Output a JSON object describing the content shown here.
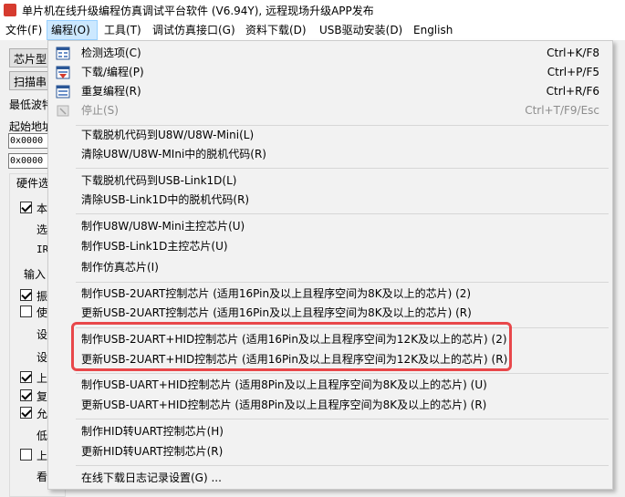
{
  "window": {
    "title": "单片机在线升级编程仿真调试平台软件 (V6.94Y), 远程现场升级APP发布"
  },
  "menubar": {
    "items": [
      {
        "label": "文件(F)"
      },
      {
        "label": "编程(O)"
      },
      {
        "label": "工具(T)"
      },
      {
        "label": "调试仿真接口(G)"
      },
      {
        "label": "资料下载(D)"
      },
      {
        "label": "USB驱动安装(D)"
      },
      {
        "label": "English"
      }
    ]
  },
  "background": {
    "chip_type_label": "芯片型",
    "scan_label": "扫描串",
    "min_baud_label": "最低波特",
    "start_addr_label": "起始地址",
    "addr1": "0x0000",
    "addr2": "0x0000",
    "hw_tab_label": "硬件选",
    "options": [
      {
        "label": "本",
        "checked": true
      },
      {
        "label": "选",
        "checked": null
      },
      {
        "label": "IR",
        "checked": null
      },
      {
        "label": "输入",
        "checked": null
      },
      {
        "label": "振",
        "checked": true
      },
      {
        "label": "使",
        "checked": false
      },
      {
        "label": "设",
        "checked": null
      },
      {
        "label": "设",
        "checked": null
      },
      {
        "label": "上",
        "checked": true
      },
      {
        "label": "复",
        "checked": true
      },
      {
        "label": "允",
        "checked": true
      },
      {
        "label": "低",
        "checked": null
      },
      {
        "label": "上",
        "checked": false
      },
      {
        "label": "看",
        "checked": null
      }
    ]
  },
  "dropdown": {
    "items": [
      {
        "label": "检测选项(C)",
        "shortcut": "Ctrl+K/F8",
        "icon": "detect-icon"
      },
      {
        "label": "下载/编程(P)",
        "shortcut": "Ctrl+P/F5",
        "icon": "download-program-icon"
      },
      {
        "label": "重复编程(R)",
        "shortcut": "Ctrl+R/F6",
        "icon": "repeat-program-icon"
      },
      {
        "label": "停止(S)",
        "shortcut": "Ctrl+T/F9/Esc",
        "icon": "stop-icon",
        "disabled": true
      },
      {
        "label": "下载脱机代码到U8W/U8W-Mini(L)",
        "shortcut": ""
      },
      {
        "label": "清除U8W/U8W-MIni中的脱机代码(R)",
        "shortcut": ""
      },
      {
        "label": "下载脱机代码到USB-Link1D(L)",
        "shortcut": ""
      },
      {
        "label": "清除USB-Link1D中的脱机代码(R)",
        "shortcut": ""
      },
      {
        "label": "制作U8W/U8W-Mini主控芯片(U)",
        "shortcut": ""
      },
      {
        "label": "制作USB-Link1D主控芯片(U)",
        "shortcut": ""
      },
      {
        "label": "制作仿真芯片(I)",
        "shortcut": ""
      },
      {
        "label": "制作USB-2UART控制芯片 (适用16Pin及以上且程序空间为8K及以上的芯片) (2)",
        "shortcut": ""
      },
      {
        "label": "更新USB-2UART控制芯片 (适用16Pin及以上且程序空间为8K及以上的芯片) (R)",
        "shortcut": ""
      },
      {
        "label": "制作USB-2UART+HID控制芯片 (适用16Pin及以上且程序空间为12K及以上的芯片) (2)",
        "shortcut": ""
      },
      {
        "label": "更新USB-2UART+HID控制芯片 (适用16Pin及以上且程序空间为12K及以上的芯片) (R)",
        "shortcut": ""
      },
      {
        "label": "制作USB-UART+HID控制芯片 (适用8Pin及以上且程序空间为8K及以上的芯片) (U)",
        "shortcut": ""
      },
      {
        "label": "更新USB-UART+HID控制芯片 (适用8Pin及以上且程序空间为8K及以上的芯片) (R)",
        "shortcut": ""
      },
      {
        "label": "制作HID转UART控制芯片(H)",
        "shortcut": ""
      },
      {
        "label": "更新HID转UART控制芯片(R)",
        "shortcut": ""
      },
      {
        "label": "在线下载日志记录设置(G) ...",
        "shortcut": ""
      }
    ]
  },
  "colors": {
    "highlight_border": "#e8474a",
    "menu_active": "#cce8ff"
  }
}
